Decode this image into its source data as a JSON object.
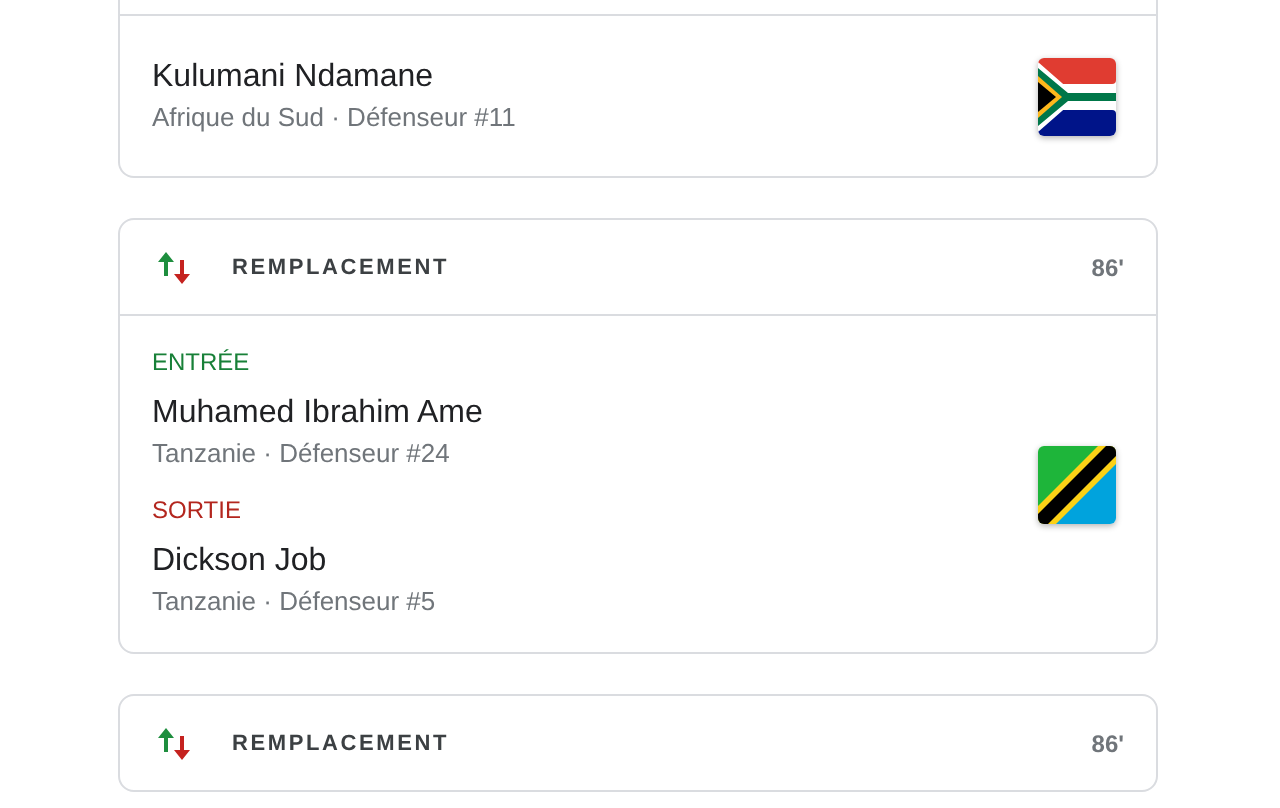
{
  "cards": [
    {
      "players": [
        {
          "name": "Kulumani Ndamane",
          "detail": "Afrique du Sud · Défenseur #11"
        }
      ],
      "flag": {
        "kind": "south_africa"
      }
    },
    {
      "header": {
        "title": "REMPLACEMENT",
        "minute": "86'"
      },
      "players": [
        {
          "role": {
            "kind": "in",
            "label": "ENTRÉE"
          },
          "name": "Muhamed Ibrahim Ame",
          "detail": "Tanzanie · Défenseur #24"
        },
        {
          "role": {
            "kind": "out",
            "label": "SORTIE"
          },
          "name": "Dickson Job",
          "detail": "Tanzanie · Défenseur #5"
        }
      ],
      "flag": {
        "kind": "tanzania"
      }
    },
    {
      "header": {
        "title": "REMPLACEMENT",
        "minute": "86'"
      }
    }
  ]
}
